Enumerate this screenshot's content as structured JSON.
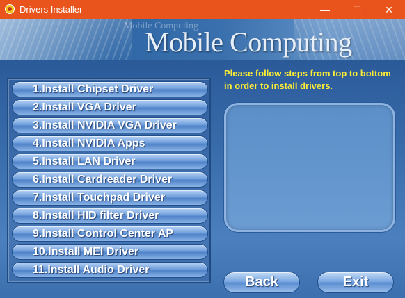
{
  "window": {
    "title": "Drivers Installer",
    "minimize": "—",
    "maximize": "☐",
    "close": "✕"
  },
  "banner": {
    "ghost_text": "Mobile Computing",
    "title": "Mobile Computing"
  },
  "drivers": [
    {
      "label": "1.Install Chipset Driver"
    },
    {
      "label": "2.Install VGA Driver"
    },
    {
      "label": "3.Install NVIDIA VGA Driver"
    },
    {
      "label": "4.Install NVIDIA Apps"
    },
    {
      "label": "5.Install LAN Driver"
    },
    {
      "label": "6.Install Cardreader Driver"
    },
    {
      "label": "7.Install Touchpad Driver"
    },
    {
      "label": "8.Install HID filter Driver"
    },
    {
      "label": "9.Install Control Center AP"
    },
    {
      "label": "10.Install MEI Driver"
    },
    {
      "label": "11.Install Audio Driver"
    }
  ],
  "instructions": "Please follow steps from top to bottom in order to install drivers.",
  "buttons": {
    "back": "Back",
    "exit": "Exit"
  },
  "colors": {
    "titlebar": "#e8541b",
    "instruction_text": "#ffee33",
    "background": "#3a6aa6"
  }
}
